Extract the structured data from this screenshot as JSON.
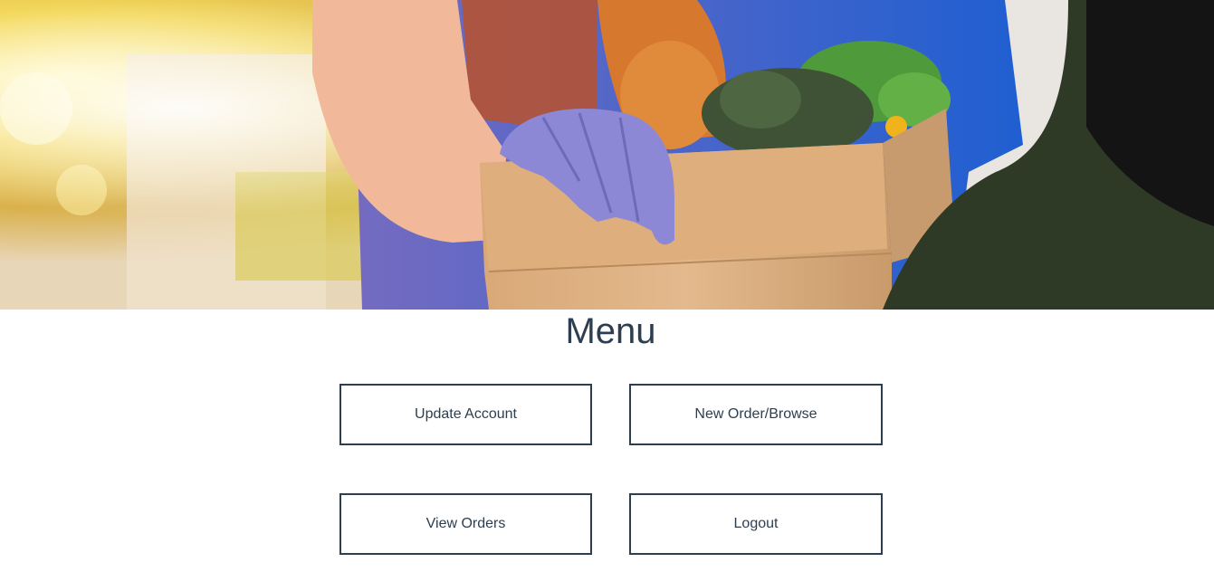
{
  "hero": {
    "image_subject": "Gloved hand handing a paper bag of groceries (bread, broccoli, greens) to a customer"
  },
  "menu": {
    "title": "Menu",
    "buttons": [
      {
        "label": "Update Account"
      },
      {
        "label": "New Order/Browse"
      },
      {
        "label": "View Orders"
      },
      {
        "label": "Logout"
      }
    ]
  },
  "colors": {
    "text": "#2c3e50",
    "border": "#2c3e50",
    "background": "#ffffff"
  }
}
